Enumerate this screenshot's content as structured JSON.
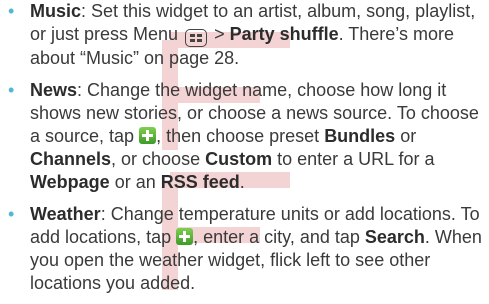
{
  "items": [
    {
      "term": "Music",
      "t1": ": Set this widget to an artist, album, song, playlist, or just press Menu ",
      "t2": " > ",
      "strong1": "Party shuffle",
      "t3": ". There’s more about “Music” on page 28."
    },
    {
      "term": "News",
      "t1": ": Change the widget name, choose how long it shows new stories, or choose a news source. To choose a source, tap ",
      "t2": ", then choose preset ",
      "strong1": "Bundles",
      "t3": " or ",
      "strong2": "Channels",
      "t4": ", or choose ",
      "strong3": "Custom",
      "t5": " to enter a URL for a ",
      "strong4": "Webpage",
      "t6": " or an ",
      "strong5": "RSS feed",
      "t7": "."
    },
    {
      "term": "Weather",
      "t1": ": Change temperature units or add locations. To add locations, tap ",
      "t2": ", enter a city, and tap ",
      "strong1": "Search",
      "t3": ". When you open the weather widget, flick left to see other locations you added."
    }
  ],
  "icons": {
    "bullet": "bullet-icon",
    "menu": "menu-key-icon",
    "plus": "plus-icon",
    "watermark": "draft-watermark"
  },
  "colors": {
    "bullet": "#4fb8d8",
    "text": "#3a3a3a",
    "plus_green": "#5cb83a",
    "watermark": "#f2d0d0"
  }
}
